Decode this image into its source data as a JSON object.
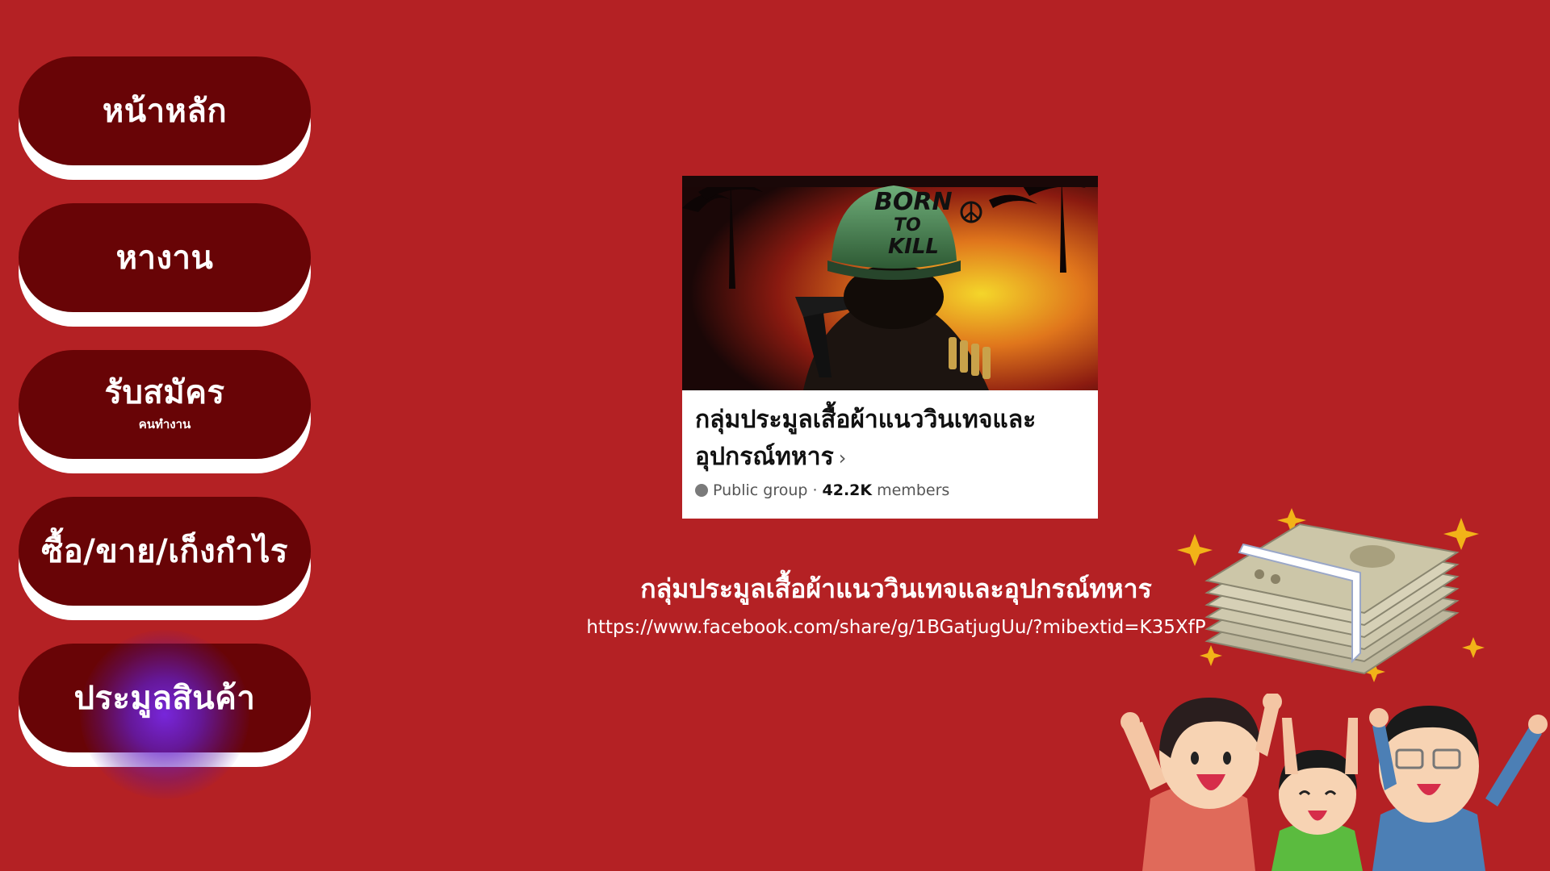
{
  "nav": {
    "items": [
      {
        "label": "หน้าหลัก",
        "sublabel": ""
      },
      {
        "label": "หางาน",
        "sublabel": ""
      },
      {
        "label": "รับสมัคร",
        "sublabel": "คนทำงาน"
      },
      {
        "label": "ซื้อ/ขาย/เก็งกำไร",
        "sublabel": ""
      },
      {
        "label": "ประมูลสินค้า",
        "sublabel": ""
      }
    ]
  },
  "card": {
    "cover_text": [
      "BORN",
      "TO",
      "KILL"
    ],
    "title_line1": "กลุ่มประมูลเสื้อผ้าแนววินเทจและ",
    "title_line2": "อุปกรณ์ทหาร",
    "chevron": "›",
    "visibility": "Public group",
    "separator": "·",
    "member_count": "42.2K",
    "members_label": "members"
  },
  "caption": "กลุ่มประมูลเสื้อผ้าแนววินเทจและอุปกรณ์ทหาร",
  "link": "https://www.facebook.com/share/g/1BGatjugUu/?mibextid=K35XfP",
  "colors": {
    "background": "#b42124",
    "button": "#680406",
    "button_shadow": "#ffffff",
    "active_glow": "#7a2be0"
  }
}
